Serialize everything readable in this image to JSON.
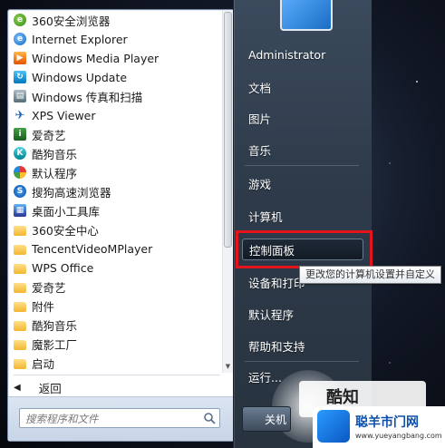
{
  "programs": [
    {
      "label": "360安全浏览器",
      "icon": "360-browser-icon"
    },
    {
      "label": "Internet Explorer",
      "icon": "ie-icon"
    },
    {
      "label": "Windows Media Player",
      "icon": "media-player-icon"
    },
    {
      "label": "Windows Update",
      "icon": "windows-update-icon"
    },
    {
      "label": "Windows 传真和扫描",
      "icon": "fax-scan-icon"
    },
    {
      "label": "XPS Viewer",
      "icon": "xps-viewer-icon"
    },
    {
      "label": "爱奇艺",
      "icon": "iqiyi-icon"
    },
    {
      "label": "酷狗音乐",
      "icon": "kugou-icon"
    },
    {
      "label": "默认程序",
      "icon": "default-programs-icon"
    },
    {
      "label": "搜狗高速浏览器",
      "icon": "sogou-browser-icon"
    },
    {
      "label": "桌面小工具库",
      "icon": "gadgets-icon"
    },
    {
      "label": "360安全中心",
      "icon": "folder-icon"
    },
    {
      "label": "TencentVideoMPlayer",
      "icon": "folder-icon"
    },
    {
      "label": "WPS Office",
      "icon": "folder-icon"
    },
    {
      "label": "爱奇艺",
      "icon": "folder-icon"
    },
    {
      "label": "附件",
      "icon": "folder-icon"
    },
    {
      "label": "酷狗音乐",
      "icon": "folder-icon"
    },
    {
      "label": "魔影工厂",
      "icon": "folder-icon"
    },
    {
      "label": "启动",
      "icon": "folder-icon"
    }
  ],
  "back_label": "返回",
  "search": {
    "placeholder": "搜索程序和文件"
  },
  "right_items": {
    "user": "Administrator",
    "documents": "文档",
    "pictures": "图片",
    "music": "音乐",
    "games": "游戏",
    "computer": "计算机",
    "control_panel": "控制面板",
    "devices": "设备和打印",
    "default_programs": "默认程序",
    "help": "帮助和支持",
    "run": "运行..."
  },
  "tooltip": "更改您的计算机设置并自定义",
  "shutdown_label": "关机",
  "watermark": {
    "text": "酷知网"
  },
  "brand": {
    "name": "聪羊市门网",
    "url": "www.yueyangbang.com"
  },
  "colors": {
    "highlight": "#e3141b",
    "right_pane": "#2e3b4b"
  }
}
